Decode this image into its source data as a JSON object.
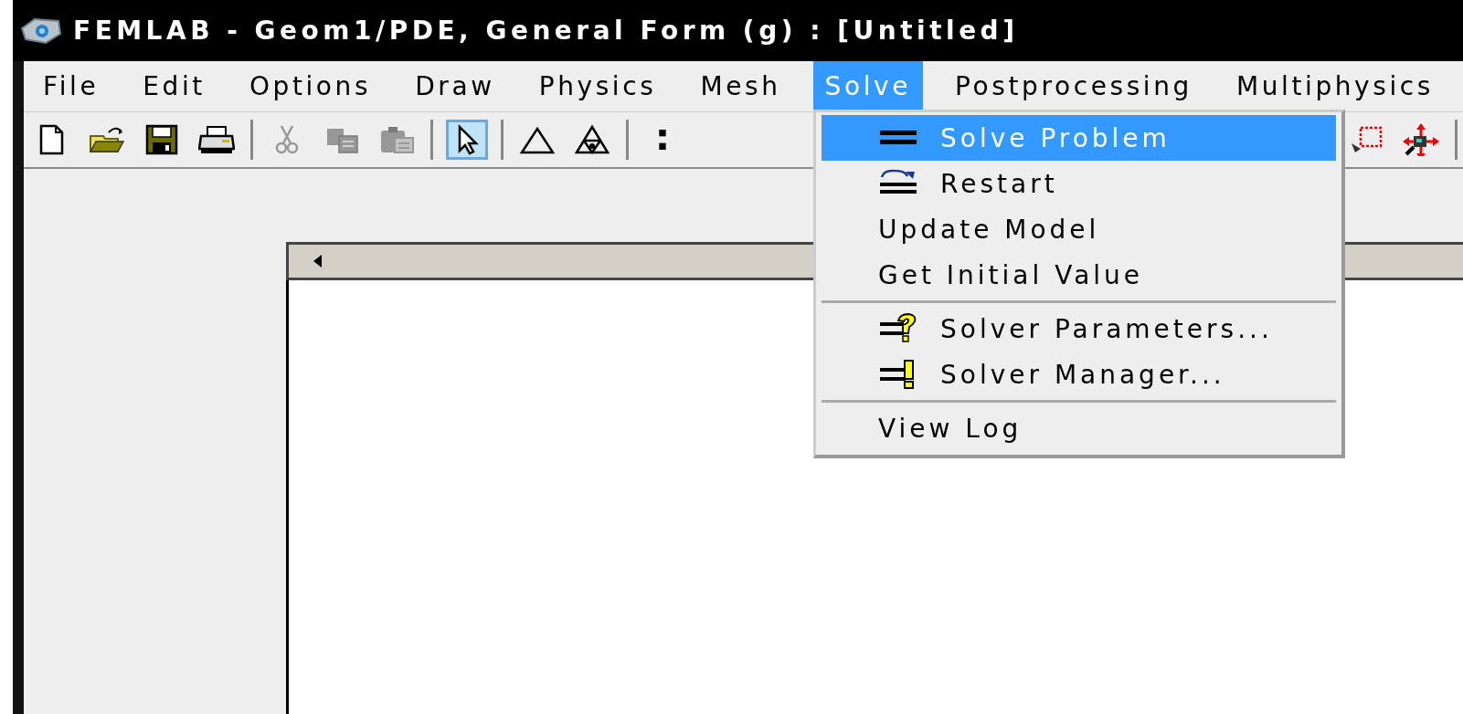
{
  "window": {
    "title": "FEMLAB - Geom1/PDE, General Form (g) : [Untitled]"
  },
  "menu_bar": [
    {
      "label": "File",
      "selected": false
    },
    {
      "label": "Edit",
      "selected": false
    },
    {
      "label": "Options",
      "selected": false
    },
    {
      "label": "Draw",
      "selected": false
    },
    {
      "label": "Physics",
      "selected": false
    },
    {
      "label": "Mesh",
      "selected": false
    },
    {
      "label": "Solve",
      "selected": true
    },
    {
      "label": "Postprocessing",
      "selected": false
    },
    {
      "label": "Multiphysics",
      "selected": false
    }
  ],
  "toolbar": {
    "left": [
      {
        "kind": "button",
        "disabled": false,
        "selected": false
      },
      {
        "kind": "button",
        "disabled": false,
        "selected": false
      },
      {
        "kind": "button",
        "disabled": false,
        "selected": false
      },
      {
        "kind": "button",
        "disabled": false,
        "selected": false
      },
      {
        "kind": "separator"
      },
      {
        "kind": "button",
        "disabled": true,
        "selected": false
      },
      {
        "kind": "button",
        "disabled": true,
        "selected": false
      },
      {
        "kind": "button",
        "disabled": true,
        "selected": false
      },
      {
        "kind": "separator"
      },
      {
        "kind": "button",
        "disabled": false,
        "selected": true
      },
      {
        "kind": "separator"
      },
      {
        "kind": "button",
        "disabled": false,
        "selected": false
      },
      {
        "kind": "button",
        "disabled": false,
        "selected": false
      },
      {
        "kind": "separator"
      },
      {
        "kind": "button",
        "disabled": false,
        "selected": false
      }
    ],
    "right": [
      {
        "kind": "button",
        "disabled": false,
        "selected": false
      },
      {
        "kind": "button",
        "disabled": false,
        "selected": false
      },
      {
        "kind": "separator"
      }
    ]
  },
  "solve_menu": [
    {
      "kind": "item",
      "label": "Solve Problem",
      "selected": true
    },
    {
      "kind": "item",
      "label": "Restart",
      "selected": false
    },
    {
      "kind": "item",
      "label": "Update Model",
      "selected": false
    },
    {
      "kind": "item",
      "label": "Get Initial Value",
      "selected": false
    },
    {
      "kind": "separator"
    },
    {
      "kind": "item",
      "label": "Solver Parameters...",
      "selected": false
    },
    {
      "kind": "item",
      "label": "Solver Manager...",
      "selected": false
    },
    {
      "kind": "separator"
    },
    {
      "kind": "item",
      "label": "View Log",
      "selected": false
    }
  ]
}
